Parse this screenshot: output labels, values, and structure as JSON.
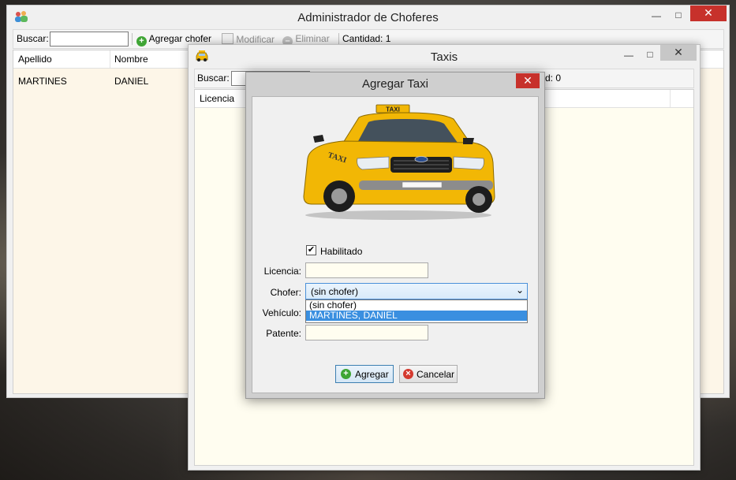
{
  "main_window": {
    "title": "Administrador de Choferes",
    "toolbar": {
      "search_label": "Buscar:",
      "search_value": "",
      "add_label": "Agregar chofer",
      "modify_label": "Modificar",
      "delete_label": "Eliminar",
      "count_label": "Cantidad: 1"
    },
    "columns": [
      "Apellido",
      "Nombre"
    ],
    "rows": [
      [
        "MARTINES",
        "DANIEL"
      ]
    ]
  },
  "taxis_window": {
    "title": "Taxis",
    "toolbar": {
      "search_label": "Buscar:",
      "count_label_partial": "d: 0"
    },
    "columns": [
      "Licencia"
    ]
  },
  "dialog": {
    "title": "Agregar Taxi",
    "image_alt": "TAXI",
    "enabled_label": "Habilitado",
    "enabled_checked": "✔",
    "license_label": "Licencia:",
    "license_value": "",
    "driver_label": "Chofer:",
    "driver_selected": "(sin chofer)",
    "driver_options": [
      "(sin chofer)",
      "MARTINES, DANIEL"
    ],
    "vehicle_label": "Vehículo:",
    "plate_label": "Patente:",
    "plate_value": "",
    "add_button": "Agregar",
    "cancel_button": "Cancelar"
  },
  "icons": {
    "add": "plus-circle-icon",
    "cancel": "x-circle-icon",
    "close": "close-icon",
    "minimize": "minimize-icon",
    "maximize": "maximize-icon"
  },
  "colors": {
    "close_red": "#c7312b",
    "add_green": "#3fa535",
    "selection_blue": "#3a8fe0",
    "grid_bg": "#fdf6e8",
    "taxi_yellow": "#f2b705"
  }
}
